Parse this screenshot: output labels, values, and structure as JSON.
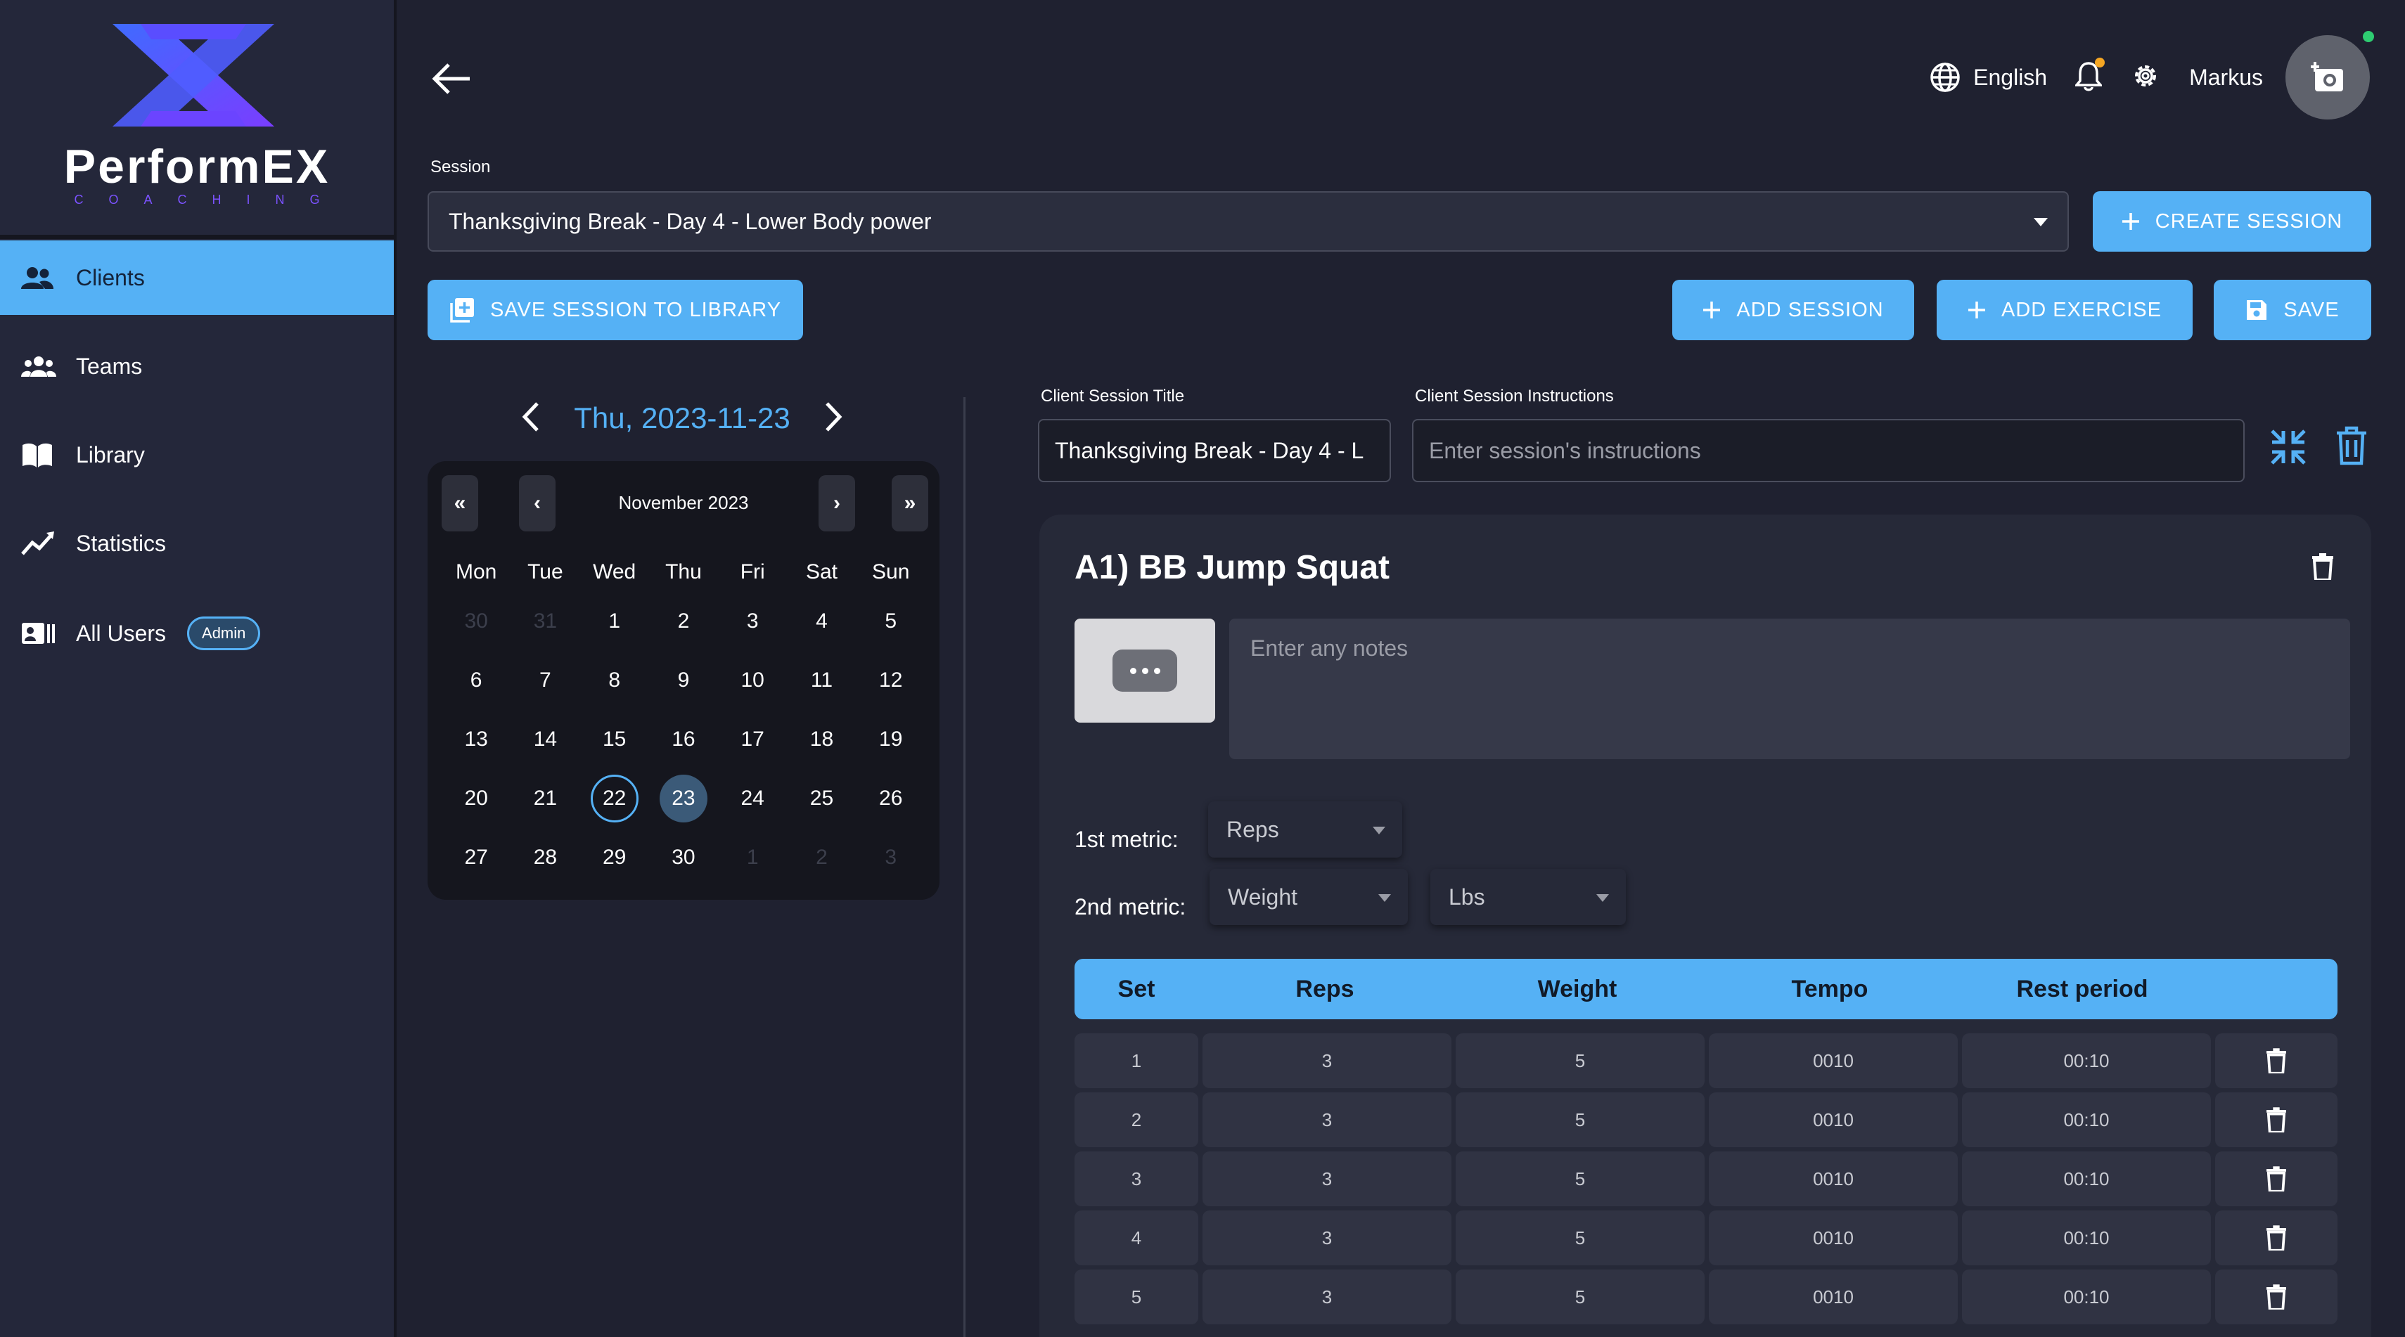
{
  "brand": {
    "name": "PerformEX",
    "tagline": "COACHING"
  },
  "sidebar": {
    "items": [
      {
        "label": "Clients",
        "active": true
      },
      {
        "label": "Teams"
      },
      {
        "label": "Library"
      },
      {
        "label": "Statistics"
      },
      {
        "label": "All Users",
        "badge": "Admin"
      }
    ]
  },
  "header": {
    "language": "English",
    "username": "Markus"
  },
  "session": {
    "label": "Session",
    "selected": "Thanksgiving Break - Day 4 - Lower Body power",
    "create_label": "CREATE SESSION",
    "save_to_library_label": "SAVE SESSION TO LIBRARY",
    "add_session_label": "ADD SESSION",
    "add_exercise_label": "ADD EXERCISE",
    "save_label": "SAVE"
  },
  "calendar": {
    "date_display": "Thu, 2023-11-23",
    "month_label": "November 2023",
    "nav": {
      "prev_year": "«",
      "prev_month": "‹",
      "next_month": "›",
      "next_year": "»"
    },
    "weekdays": [
      "Mon",
      "Tue",
      "Wed",
      "Thu",
      "Fri",
      "Sat",
      "Sun"
    ],
    "weeks": [
      [
        "30",
        "31",
        "1",
        "2",
        "3",
        "4",
        "5"
      ],
      [
        "6",
        "7",
        "8",
        "9",
        "10",
        "11",
        "12"
      ],
      [
        "13",
        "14",
        "15",
        "16",
        "17",
        "18",
        "19"
      ],
      [
        "20",
        "21",
        "22",
        "23",
        "24",
        "25",
        "26"
      ],
      [
        "27",
        "28",
        "29",
        "30",
        "1",
        "2",
        "3"
      ]
    ],
    "today": "22",
    "selected": "23"
  },
  "client_session": {
    "title_label": "Client Session Title",
    "title_value": "Thanksgiving Break - Day 4 - L",
    "instructions_label": "Client Session Instructions",
    "instructions_placeholder": "Enter session's instructions"
  },
  "exercise": {
    "title": "A1) BB Jump Squat",
    "notes_placeholder": "Enter any notes",
    "metric1_label": "1st metric:",
    "metric1_value": "Reps",
    "metric2_label": "2nd metric:",
    "metric2_value": "Weight",
    "unit_value": "Lbs",
    "table": {
      "headers": [
        "Set",
        "Reps",
        "Weight",
        "Tempo",
        "Rest period"
      ],
      "rows": [
        [
          "1",
          "3",
          "5",
          "0010",
          "00:10"
        ],
        [
          "2",
          "3",
          "5",
          "0010",
          "00:10"
        ],
        [
          "3",
          "3",
          "5",
          "0010",
          "00:10"
        ],
        [
          "4",
          "3",
          "5",
          "0010",
          "00:10"
        ],
        [
          "5",
          "3",
          "5",
          "0010",
          "00:10"
        ]
      ]
    }
  },
  "colors": {
    "accent": "#55b1f5",
    "background": "#1f2130",
    "sidebar": "#24273a",
    "card": "#262938"
  }
}
